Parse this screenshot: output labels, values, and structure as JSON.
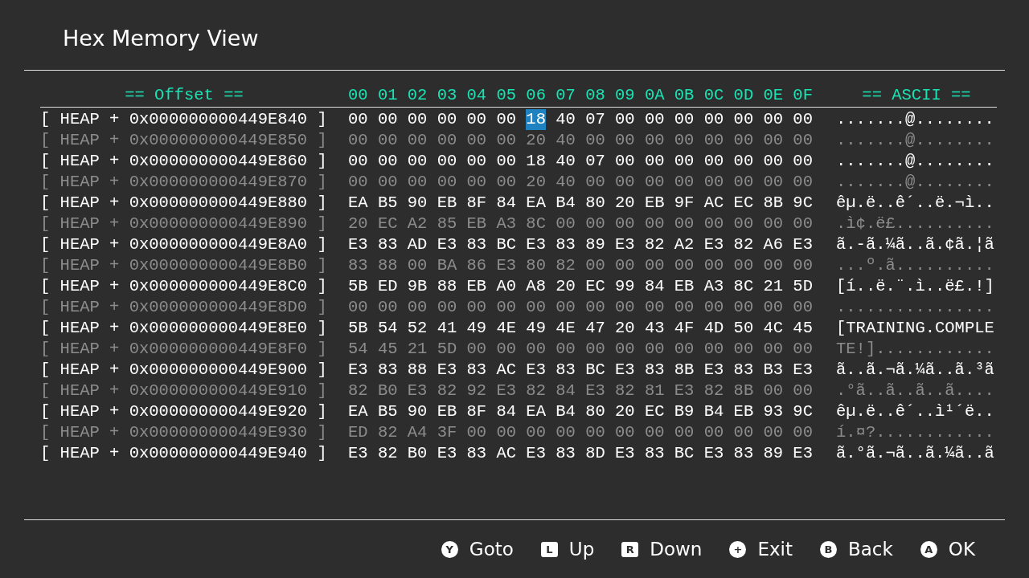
{
  "window": {
    "title": "Hex Memory View"
  },
  "header": {
    "offset": "== Offset ==",
    "columns": [
      "00",
      "01",
      "02",
      "03",
      "04",
      "05",
      "06",
      "07",
      "08",
      "09",
      "0A",
      "0B",
      "0C",
      "0D",
      "0E",
      "0F"
    ],
    "ascii": "== ASCII =="
  },
  "rows": [
    {
      "offset": "[ HEAP + 0x000000000449E840 ]",
      "dim": false,
      "ascii": ".......@........",
      "bytes": [
        {
          "v": "00",
          "selected": false
        },
        {
          "v": "00",
          "selected": false
        },
        {
          "v": "00",
          "selected": false
        },
        {
          "v": "00",
          "selected": false
        },
        {
          "v": "00",
          "selected": false
        },
        {
          "v": "00",
          "selected": false
        },
        {
          "v": "18",
          "selected": true
        },
        {
          "v": "40",
          "selected": false
        },
        {
          "v": "07",
          "selected": false
        },
        {
          "v": "00",
          "selected": false
        },
        {
          "v": "00",
          "selected": false
        },
        {
          "v": "00",
          "selected": false
        },
        {
          "v": "00",
          "selected": false
        },
        {
          "v": "00",
          "selected": false
        },
        {
          "v": "00",
          "selected": false
        },
        {
          "v": "00",
          "selected": false
        }
      ]
    },
    {
      "offset": "[ HEAP + 0x000000000449E850 ]",
      "dim": true,
      "ascii": ".......@........",
      "bytes": [
        {
          "v": "00",
          "selected": false
        },
        {
          "v": "00",
          "selected": false
        },
        {
          "v": "00",
          "selected": false
        },
        {
          "v": "00",
          "selected": false
        },
        {
          "v": "00",
          "selected": false
        },
        {
          "v": "00",
          "selected": false
        },
        {
          "v": "20",
          "selected": false
        },
        {
          "v": "40",
          "selected": false
        },
        {
          "v": "00",
          "selected": false
        },
        {
          "v": "00",
          "selected": false
        },
        {
          "v": "00",
          "selected": false
        },
        {
          "v": "00",
          "selected": false
        },
        {
          "v": "00",
          "selected": false
        },
        {
          "v": "00",
          "selected": false
        },
        {
          "v": "00",
          "selected": false
        },
        {
          "v": "00",
          "selected": false
        }
      ]
    },
    {
      "offset": "[ HEAP + 0x000000000449E860 ]",
      "dim": false,
      "ascii": ".......@........",
      "bytes": [
        {
          "v": "00",
          "selected": false
        },
        {
          "v": "00",
          "selected": false
        },
        {
          "v": "00",
          "selected": false
        },
        {
          "v": "00",
          "selected": false
        },
        {
          "v": "00",
          "selected": false
        },
        {
          "v": "00",
          "selected": false
        },
        {
          "v": "18",
          "selected": false
        },
        {
          "v": "40",
          "selected": false
        },
        {
          "v": "07",
          "selected": false
        },
        {
          "v": "00",
          "selected": false
        },
        {
          "v": "00",
          "selected": false
        },
        {
          "v": "00",
          "selected": false
        },
        {
          "v": "00",
          "selected": false
        },
        {
          "v": "00",
          "selected": false
        },
        {
          "v": "00",
          "selected": false
        },
        {
          "v": "00",
          "selected": false
        }
      ]
    },
    {
      "offset": "[ HEAP + 0x000000000449E870 ]",
      "dim": true,
      "ascii": ".......@........",
      "bytes": [
        {
          "v": "00",
          "selected": false
        },
        {
          "v": "00",
          "selected": false
        },
        {
          "v": "00",
          "selected": false
        },
        {
          "v": "00",
          "selected": false
        },
        {
          "v": "00",
          "selected": false
        },
        {
          "v": "00",
          "selected": false
        },
        {
          "v": "20",
          "selected": false
        },
        {
          "v": "40",
          "selected": false
        },
        {
          "v": "00",
          "selected": false
        },
        {
          "v": "00",
          "selected": false
        },
        {
          "v": "00",
          "selected": false
        },
        {
          "v": "00",
          "selected": false
        },
        {
          "v": "00",
          "selected": false
        },
        {
          "v": "00",
          "selected": false
        },
        {
          "v": "00",
          "selected": false
        },
        {
          "v": "00",
          "selected": false
        }
      ]
    },
    {
      "offset": "[ HEAP + 0x000000000449E880 ]",
      "dim": false,
      "ascii": "êµ.ë..ê´..ë.¬ì..",
      "bytes": [
        {
          "v": "EA",
          "selected": false
        },
        {
          "v": "B5",
          "selected": false
        },
        {
          "v": "90",
          "selected": false
        },
        {
          "v": "EB",
          "selected": false
        },
        {
          "v": "8F",
          "selected": false
        },
        {
          "v": "84",
          "selected": false
        },
        {
          "v": "EA",
          "selected": false
        },
        {
          "v": "B4",
          "selected": false
        },
        {
          "v": "80",
          "selected": false
        },
        {
          "v": "20",
          "selected": false
        },
        {
          "v": "EB",
          "selected": false
        },
        {
          "v": "9F",
          "selected": false
        },
        {
          "v": "AC",
          "selected": false
        },
        {
          "v": "EC",
          "selected": false
        },
        {
          "v": "8B",
          "selected": false
        },
        {
          "v": "9C",
          "selected": false
        }
      ]
    },
    {
      "offset": "[ HEAP + 0x000000000449E890 ]",
      "dim": true,
      "ascii": ".ì¢.ë£..........",
      "bytes": [
        {
          "v": "20",
          "selected": false
        },
        {
          "v": "EC",
          "selected": false
        },
        {
          "v": "A2",
          "selected": false
        },
        {
          "v": "85",
          "selected": false
        },
        {
          "v": "EB",
          "selected": false
        },
        {
          "v": "A3",
          "selected": false
        },
        {
          "v": "8C",
          "selected": false
        },
        {
          "v": "00",
          "selected": false
        },
        {
          "v": "00",
          "selected": false
        },
        {
          "v": "00",
          "selected": false
        },
        {
          "v": "00",
          "selected": false
        },
        {
          "v": "00",
          "selected": false
        },
        {
          "v": "00",
          "selected": false
        },
        {
          "v": "00",
          "selected": false
        },
        {
          "v": "00",
          "selected": false
        },
        {
          "v": "00",
          "selected": false
        }
      ]
    },
    {
      "offset": "[ HEAP + 0x000000000449E8A0 ]",
      "dim": false,
      "ascii": "ã.-ã.¼ã..ã.¢ã.¦ã",
      "bytes": [
        {
          "v": "E3",
          "selected": false
        },
        {
          "v": "83",
          "selected": false
        },
        {
          "v": "AD",
          "selected": false
        },
        {
          "v": "E3",
          "selected": false
        },
        {
          "v": "83",
          "selected": false
        },
        {
          "v": "BC",
          "selected": false
        },
        {
          "v": "E3",
          "selected": false
        },
        {
          "v": "83",
          "selected": false
        },
        {
          "v": "89",
          "selected": false
        },
        {
          "v": "E3",
          "selected": false
        },
        {
          "v": "82",
          "selected": false
        },
        {
          "v": "A2",
          "selected": false
        },
        {
          "v": "E3",
          "selected": false
        },
        {
          "v": "82",
          "selected": false
        },
        {
          "v": "A6",
          "selected": false
        },
        {
          "v": "E3",
          "selected": false
        }
      ]
    },
    {
      "offset": "[ HEAP + 0x000000000449E8B0 ]",
      "dim": true,
      "ascii": "...º.ã..........",
      "bytes": [
        {
          "v": "83",
          "selected": false
        },
        {
          "v": "88",
          "selected": false
        },
        {
          "v": "00",
          "selected": false
        },
        {
          "v": "BA",
          "selected": false
        },
        {
          "v": "86",
          "selected": false
        },
        {
          "v": "E3",
          "selected": false
        },
        {
          "v": "80",
          "selected": false
        },
        {
          "v": "82",
          "selected": false
        },
        {
          "v": "00",
          "selected": false
        },
        {
          "v": "00",
          "selected": false
        },
        {
          "v": "00",
          "selected": false
        },
        {
          "v": "00",
          "selected": false
        },
        {
          "v": "00",
          "selected": false
        },
        {
          "v": "00",
          "selected": false
        },
        {
          "v": "00",
          "selected": false
        },
        {
          "v": "00",
          "selected": false
        }
      ]
    },
    {
      "offset": "[ HEAP + 0x000000000449E8C0 ]",
      "dim": false,
      "ascii": "[í..ë.¨.ì..ë£.!]",
      "bytes": [
        {
          "v": "5B",
          "selected": false
        },
        {
          "v": "ED",
          "selected": false
        },
        {
          "v": "9B",
          "selected": false
        },
        {
          "v": "88",
          "selected": false
        },
        {
          "v": "EB",
          "selected": false
        },
        {
          "v": "A0",
          "selected": false
        },
        {
          "v": "A8",
          "selected": false
        },
        {
          "v": "20",
          "selected": false
        },
        {
          "v": "EC",
          "selected": false
        },
        {
          "v": "99",
          "selected": false
        },
        {
          "v": "84",
          "selected": false
        },
        {
          "v": "EB",
          "selected": false
        },
        {
          "v": "A3",
          "selected": false
        },
        {
          "v": "8C",
          "selected": false
        },
        {
          "v": "21",
          "selected": false
        },
        {
          "v": "5D",
          "selected": false
        }
      ]
    },
    {
      "offset": "[ HEAP + 0x000000000449E8D0 ]",
      "dim": true,
      "ascii": "................",
      "bytes": [
        {
          "v": "00",
          "selected": false
        },
        {
          "v": "00",
          "selected": false
        },
        {
          "v": "00",
          "selected": false
        },
        {
          "v": "00",
          "selected": false
        },
        {
          "v": "00",
          "selected": false
        },
        {
          "v": "00",
          "selected": false
        },
        {
          "v": "00",
          "selected": false
        },
        {
          "v": "00",
          "selected": false
        },
        {
          "v": "00",
          "selected": false
        },
        {
          "v": "00",
          "selected": false
        },
        {
          "v": "00",
          "selected": false
        },
        {
          "v": "00",
          "selected": false
        },
        {
          "v": "00",
          "selected": false
        },
        {
          "v": "00",
          "selected": false
        },
        {
          "v": "00",
          "selected": false
        },
        {
          "v": "00",
          "selected": false
        }
      ]
    },
    {
      "offset": "[ HEAP + 0x000000000449E8E0 ]",
      "dim": false,
      "ascii": "[TRAINING.COMPLE",
      "bytes": [
        {
          "v": "5B",
          "selected": false
        },
        {
          "v": "54",
          "selected": false
        },
        {
          "v": "52",
          "selected": false
        },
        {
          "v": "41",
          "selected": false
        },
        {
          "v": "49",
          "selected": false
        },
        {
          "v": "4E",
          "selected": false
        },
        {
          "v": "49",
          "selected": false
        },
        {
          "v": "4E",
          "selected": false
        },
        {
          "v": "47",
          "selected": false
        },
        {
          "v": "20",
          "selected": false
        },
        {
          "v": "43",
          "selected": false
        },
        {
          "v": "4F",
          "selected": false
        },
        {
          "v": "4D",
          "selected": false
        },
        {
          "v": "50",
          "selected": false
        },
        {
          "v": "4C",
          "selected": false
        },
        {
          "v": "45",
          "selected": false
        }
      ]
    },
    {
      "offset": "[ HEAP + 0x000000000449E8F0 ]",
      "dim": true,
      "ascii": "TE!]............",
      "bytes": [
        {
          "v": "54",
          "selected": false
        },
        {
          "v": "45",
          "selected": false
        },
        {
          "v": "21",
          "selected": false
        },
        {
          "v": "5D",
          "selected": false
        },
        {
          "v": "00",
          "selected": false
        },
        {
          "v": "00",
          "selected": false
        },
        {
          "v": "00",
          "selected": false
        },
        {
          "v": "00",
          "selected": false
        },
        {
          "v": "00",
          "selected": false
        },
        {
          "v": "00",
          "selected": false
        },
        {
          "v": "00",
          "selected": false
        },
        {
          "v": "00",
          "selected": false
        },
        {
          "v": "00",
          "selected": false
        },
        {
          "v": "00",
          "selected": false
        },
        {
          "v": "00",
          "selected": false
        },
        {
          "v": "00",
          "selected": false
        }
      ]
    },
    {
      "offset": "[ HEAP + 0x000000000449E900 ]",
      "dim": false,
      "ascii": "ã..ã.¬ã.¼ã..ã.³ã",
      "bytes": [
        {
          "v": "E3",
          "selected": false
        },
        {
          "v": "83",
          "selected": false
        },
        {
          "v": "88",
          "selected": false
        },
        {
          "v": "E3",
          "selected": false
        },
        {
          "v": "83",
          "selected": false
        },
        {
          "v": "AC",
          "selected": false
        },
        {
          "v": "E3",
          "selected": false
        },
        {
          "v": "83",
          "selected": false
        },
        {
          "v": "BC",
          "selected": false
        },
        {
          "v": "E3",
          "selected": false
        },
        {
          "v": "83",
          "selected": false
        },
        {
          "v": "8B",
          "selected": false
        },
        {
          "v": "E3",
          "selected": false
        },
        {
          "v": "83",
          "selected": false
        },
        {
          "v": "B3",
          "selected": false
        },
        {
          "v": "E3",
          "selected": false
        }
      ]
    },
    {
      "offset": "[ HEAP + 0x000000000449E910 ]",
      "dim": true,
      "ascii": ".°ã..ã..ã..ã....",
      "bytes": [
        {
          "v": "82",
          "selected": false
        },
        {
          "v": "B0",
          "selected": false
        },
        {
          "v": "E3",
          "selected": false
        },
        {
          "v": "82",
          "selected": false
        },
        {
          "v": "92",
          "selected": false
        },
        {
          "v": "E3",
          "selected": false
        },
        {
          "v": "82",
          "selected": false
        },
        {
          "v": "84",
          "selected": false
        },
        {
          "v": "E3",
          "selected": false
        },
        {
          "v": "82",
          "selected": false
        },
        {
          "v": "81",
          "selected": false
        },
        {
          "v": "E3",
          "selected": false
        },
        {
          "v": "82",
          "selected": false
        },
        {
          "v": "8B",
          "selected": false
        },
        {
          "v": "00",
          "selected": false
        },
        {
          "v": "00",
          "selected": false
        }
      ]
    },
    {
      "offset": "[ HEAP + 0x000000000449E920 ]",
      "dim": false,
      "ascii": "êµ.ë..ê´..ì¹´ë..",
      "bytes": [
        {
          "v": "EA",
          "selected": false
        },
        {
          "v": "B5",
          "selected": false
        },
        {
          "v": "90",
          "selected": false
        },
        {
          "v": "EB",
          "selected": false
        },
        {
          "v": "8F",
          "selected": false
        },
        {
          "v": "84",
          "selected": false
        },
        {
          "v": "EA",
          "selected": false
        },
        {
          "v": "B4",
          "selected": false
        },
        {
          "v": "80",
          "selected": false
        },
        {
          "v": "20",
          "selected": false
        },
        {
          "v": "EC",
          "selected": false
        },
        {
          "v": "B9",
          "selected": false
        },
        {
          "v": "B4",
          "selected": false
        },
        {
          "v": "EB",
          "selected": false
        },
        {
          "v": "93",
          "selected": false
        },
        {
          "v": "9C",
          "selected": false
        }
      ]
    },
    {
      "offset": "[ HEAP + 0x000000000449E930 ]",
      "dim": true,
      "ascii": "í.¤?............",
      "bytes": [
        {
          "v": "ED",
          "selected": false
        },
        {
          "v": "82",
          "selected": false
        },
        {
          "v": "A4",
          "selected": false
        },
        {
          "v": "3F",
          "selected": false
        },
        {
          "v": "00",
          "selected": false
        },
        {
          "v": "00",
          "selected": false
        },
        {
          "v": "00",
          "selected": false
        },
        {
          "v": "00",
          "selected": false
        },
        {
          "v": "00",
          "selected": false
        },
        {
          "v": "00",
          "selected": false
        },
        {
          "v": "00",
          "selected": false
        },
        {
          "v": "00",
          "selected": false
        },
        {
          "v": "00",
          "selected": false
        },
        {
          "v": "00",
          "selected": false
        },
        {
          "v": "00",
          "selected": false
        },
        {
          "v": "00",
          "selected": false
        }
      ]
    },
    {
      "offset": "[ HEAP + 0x000000000449E940 ]",
      "dim": false,
      "ascii": "ã.°ã.¬ã..ã.¼ã..ã",
      "bytes": [
        {
          "v": "E3",
          "selected": false
        },
        {
          "v": "82",
          "selected": false
        },
        {
          "v": "B0",
          "selected": false
        },
        {
          "v": "E3",
          "selected": false
        },
        {
          "v": "83",
          "selected": false
        },
        {
          "v": "AC",
          "selected": false
        },
        {
          "v": "E3",
          "selected": false
        },
        {
          "v": "83",
          "selected": false
        },
        {
          "v": "8D",
          "selected": false
        },
        {
          "v": "E3",
          "selected": false
        },
        {
          "v": "83",
          "selected": false
        },
        {
          "v": "BC",
          "selected": false
        },
        {
          "v": "E3",
          "selected": false
        },
        {
          "v": "83",
          "selected": false
        },
        {
          "v": "89",
          "selected": false
        },
        {
          "v": "E3",
          "selected": false
        }
      ]
    }
  ],
  "footer": {
    "actions": [
      {
        "kind": "round",
        "key": "Y",
        "label": "Goto"
      },
      {
        "kind": "square",
        "key": "L",
        "label": "Up"
      },
      {
        "kind": "square",
        "key": "R",
        "label": "Down"
      },
      {
        "kind": "round",
        "key": "+",
        "label": "Exit"
      },
      {
        "kind": "round",
        "key": "B",
        "label": "Back"
      },
      {
        "kind": "round",
        "key": "A",
        "label": "OK"
      }
    ]
  }
}
